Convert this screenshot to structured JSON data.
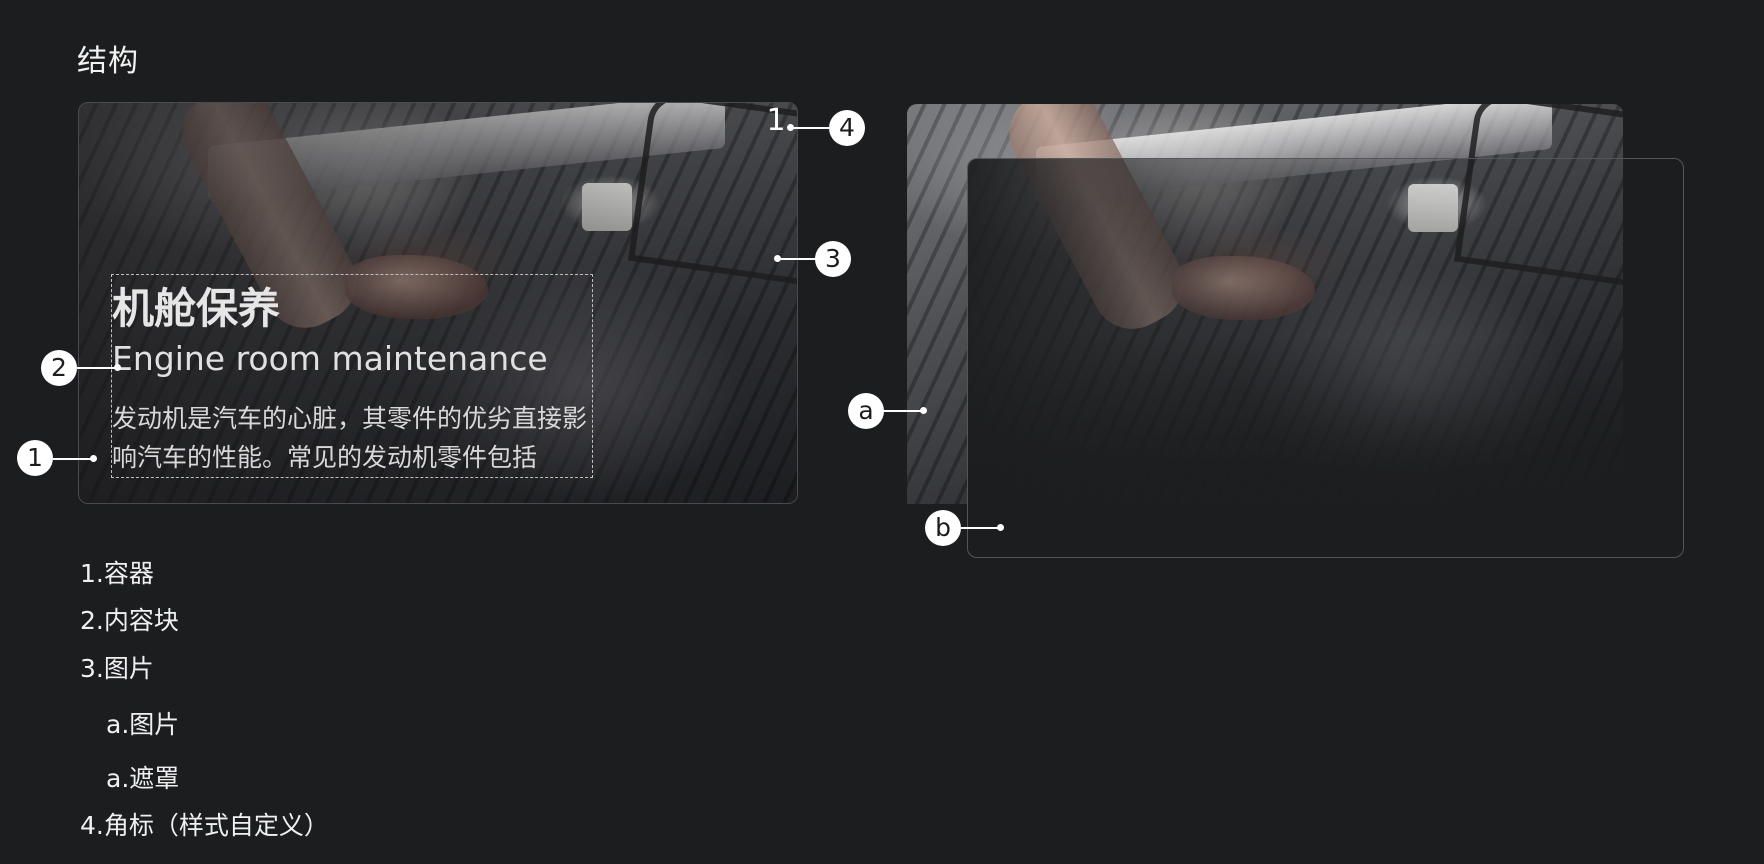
{
  "section_title": "结构",
  "card": {
    "corner_badge": "1",
    "title_zh": "机舱保养",
    "title_en": "Engine room maintenance",
    "description": "发动机是汽车的心脏，其零件的优劣直接影响汽车的性能。常见的发动机零件包括"
  },
  "callouts": {
    "c1": "1",
    "c2": "2",
    "c3": "3",
    "c4": "4",
    "ca": "a",
    "cb": "b"
  },
  "legend": [
    "1.容器",
    "2.内容块",
    "3.图片",
    "a.图片",
    "a.遮罩",
    "4.角标（样式自定义）"
  ],
  "colors": {
    "background": "#1c1d1f",
    "badge": "#ffffff"
  }
}
